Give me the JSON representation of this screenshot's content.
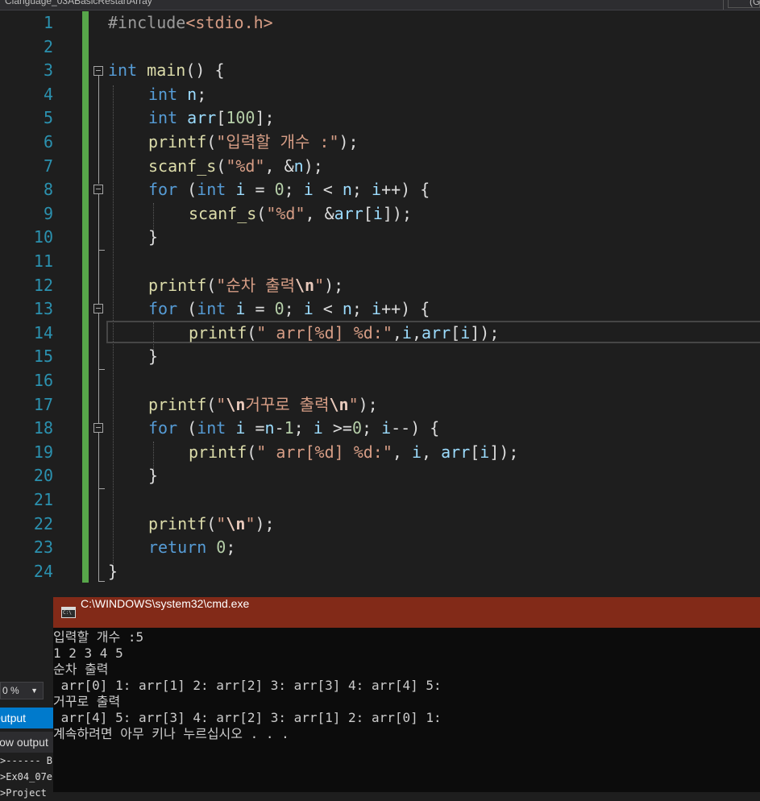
{
  "window": {
    "tab_title": "Clanguage_03ABasicRestartArray",
    "right_tab": "(G"
  },
  "editor": {
    "line_numbers": [
      "1",
      "2",
      "3",
      "4",
      "5",
      "6",
      "7",
      "8",
      "9",
      "10",
      "11",
      "12",
      "13",
      "14",
      "15",
      "16",
      "17",
      "18",
      "19",
      "20",
      "21",
      "22",
      "23",
      "24"
    ],
    "code": {
      "l1_pp": "#include",
      "l1_inc": "<stdio.h>",
      "l3_kw": "int",
      "l3_fn": "main",
      "l3_rest": "() {",
      "l4_kw": "int",
      "l4_var": "n",
      "l4_rest": ";",
      "l5_kw": "int",
      "l5_var": "arr",
      "l5_open": "[",
      "l5_num": "100",
      "l5_close": "];",
      "l6_fn": "printf",
      "l6_open": "(",
      "l6_str": "\"입력할 개수 :\"",
      "l6_close": ");",
      "l7_fn": "scanf_s",
      "l7_open": "(",
      "l7_str": "\"%d\"",
      "l7_mid": ", &",
      "l7_var": "n",
      "l7_close": ");",
      "l8_kw": "for",
      "l8_a": " (",
      "l8_kw2": "int",
      "l8_var": " i",
      "l8_b": " = ",
      "l8_num": "0",
      "l8_c": "; ",
      "l8_var2": "i",
      "l8_d": " < ",
      "l8_var3": "n",
      "l8_e": "; ",
      "l8_var4": "i",
      "l8_f": "++) {",
      "l9_fn": "scanf_s",
      "l9_open": "(",
      "l9_str": "\"%d\"",
      "l9_mid": ", &",
      "l9_var": "arr",
      "l9_b": "[",
      "l9_var2": "i",
      "l9_close": "]);",
      "l10": "}",
      "l12_fn": "printf",
      "l12_open": "(",
      "l12_str": "\"순차 출력",
      "l12_esc": "\\n",
      "l12_str2": "\"",
      "l12_close": ");",
      "l13_kw": "for",
      "l13_a": " (",
      "l13_kw2": "int",
      "l13_var": " i",
      "l13_b": " = ",
      "l13_num": "0",
      "l13_c": "; ",
      "l13_var2": "i",
      "l13_d": " < ",
      "l13_var3": "n",
      "l13_e": "; ",
      "l13_var4": "i",
      "l13_f": "++) {",
      "l14_fn": "printf",
      "l14_open": "(",
      "l14_str": "\" arr[%d] %d:\"",
      "l14_a": ",",
      "l14_var": "i",
      "l14_b": ",",
      "l14_var2": "arr",
      "l14_c": "[",
      "l14_var3": "i",
      "l14_close": "]);",
      "l15": "}",
      "l17_fn": "printf",
      "l17_open": "(",
      "l17_str0": "\"",
      "l17_esc": "\\n",
      "l17_str": "거꾸로 출력",
      "l17_esc2": "\\n",
      "l17_str2": "\"",
      "l17_close": ");",
      "l18_kw": "for",
      "l18_a": " (",
      "l18_kw2": "int",
      "l18_var": " i",
      "l18_b": " =",
      "l18_var2": "n",
      "l18_c": "-",
      "l18_num": "1",
      "l18_d": "; ",
      "l18_var3": "i",
      "l18_e": " >=",
      "l18_num2": "0",
      "l18_f": "; ",
      "l18_var4": "i",
      "l18_g": "--) {",
      "l19_fn": "printf",
      "l19_open": "(",
      "l19_str": "\" arr[%d] %d:\"",
      "l19_a": ", ",
      "l19_var": "i",
      "l19_b": ", ",
      "l19_var2": "arr",
      "l19_c": "[",
      "l19_var3": "i",
      "l19_close": "]);",
      "l20": "}",
      "l22_fn": "printf",
      "l22_open": "(",
      "l22_str": "\"",
      "l22_esc": "\\n",
      "l22_str2": "\"",
      "l22_close": ");",
      "l23_kw": "return",
      "l23_sp": " ",
      "l23_num": "0",
      "l23_close": ";",
      "l24": "}"
    }
  },
  "bottom_panel": {
    "zoom": "0 %",
    "output_tab": "Output",
    "show_output": "Show output",
    "lines": [
      ">------ B",
      ">Ex04_07e",
      ">Project"
    ]
  },
  "console": {
    "title": "C:\\WINDOWS\\system32\\cmd.exe",
    "lines": [
      "입력할 개수 :5",
      "1 2 3 4 5",
      "순차 출력",
      " arr[0] 1: arr[1] 2: arr[2] 3: arr[3] 4: arr[4] 5:",
      "거꾸로 출력",
      " arr[4] 5: arr[3] 4: arr[2] 3: arr[1] 2: arr[0] 1:",
      "계속하려면 아무 키나 누르십시오 . . ."
    ]
  }
}
